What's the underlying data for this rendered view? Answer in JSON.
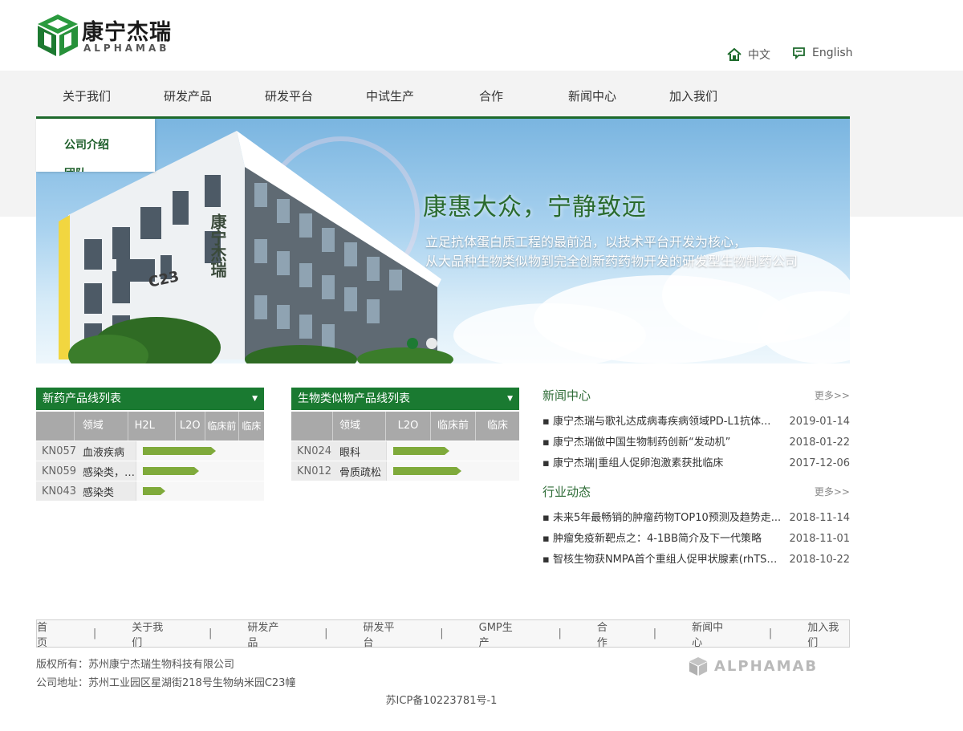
{
  "header": {
    "brand_cn": "康宁杰瑞",
    "brand_en": "ALPHAMAB",
    "lang_zh": "中文",
    "lang_en": "English"
  },
  "nav": [
    "关于我们",
    "研发产品",
    "研发平台",
    "中试生产",
    "合作",
    "新闻中心",
    "加入我们"
  ],
  "dropdown": [
    "公司介绍",
    "团队"
  ],
  "banner": {
    "title": "康惠大众，宁静致远",
    "line1": "立足抗体蛋白质工程的最前沿，以技术平台开发为核心，",
    "line2": "从大品种生物类似物到完全创新药药物开发的研发型生物制药公司",
    "building_label": "康宁杰瑞",
    "building_code": "C23"
  },
  "tables": [
    {
      "title": "新药产品线列表",
      "cols": [
        "",
        "领域",
        "H2L",
        "L2O",
        "临床前",
        "临床"
      ],
      "rows": [
        {
          "code": "KN057",
          "area": "血液疾病",
          "progress": 0.62
        },
        {
          "code": "KN059",
          "area": "感染类，…",
          "progress": 0.47
        },
        {
          "code": "KN043",
          "area": "感染类",
          "progress": 0.16
        }
      ]
    },
    {
      "title": "生物类似物产品线列表",
      "cols": [
        "",
        "领域",
        "L2O",
        "临床前",
        "临床"
      ],
      "rows": [
        {
          "code": "KN024",
          "area": "眼科",
          "progress": 0.45
        },
        {
          "code": "KN012",
          "area": "骨质疏松",
          "progress": 0.55
        }
      ]
    }
  ],
  "news": {
    "title": "新闻中心",
    "more": "更多>>",
    "items": [
      {
        "title": "▪ 康宁杰瑞与歌礼达成病毒疾病领域PD-L1抗体...",
        "date": "2019-01-14"
      },
      {
        "title": "▪ 康宁杰瑞做中国生物制药创新“发动机”",
        "date": "2018-01-22"
      },
      {
        "title": "▪ 康宁杰瑞|重组人促卵泡激素获批临床",
        "date": "2017-12-06"
      }
    ]
  },
  "industry": {
    "title": "行业动态",
    "more": "更多>>",
    "items": [
      {
        "title": "▪ 未来5年最畅销的肿瘤药物TOP10预测及趋势走...",
        "date": "2018-11-14"
      },
      {
        "title": "▪ 肿瘤免疫新靶点之：4-1BB简介及下一代策略",
        "date": "2018-11-01"
      },
      {
        "title": "▪ 智核生物获NMPA首个重组人促甲状腺素(rhTSH...",
        "date": "2018-10-22"
      }
    ]
  },
  "footer": {
    "links": [
      "首页",
      "关于我们",
      "研发产品",
      "研发平台",
      "GMP生产",
      "合作",
      "新闻中心",
      "加入我们"
    ],
    "separator": "|",
    "copyright": "版权所有：苏州康宁杰瑞生物科技有限公司",
    "address": "公司地址：苏州工业园区星湖街218号生物纳米园C23幢",
    "icp": "苏ICP备10223781号-1",
    "logo_text": "ALPHAMAB"
  },
  "colors": {
    "brand_green": "#1a7a31",
    "dark_green": "#1d6a2c",
    "bar_green": "#7faa3b"
  },
  "icons": [
    "home-icon",
    "message-icon",
    "cube-logo-icon",
    "dropdown-caret-icon"
  ]
}
